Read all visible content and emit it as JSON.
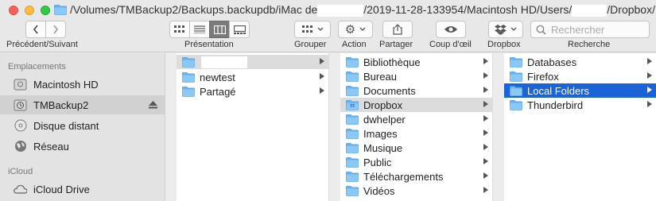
{
  "window": {
    "title_part1": "/Volumes/TMBackup2/Backups.backupdb/iMac de",
    "title_part2": "/2019-11-28-133954/Macintosh HD/Users/",
    "title_part3": "/Dropbox/Loc…"
  },
  "toolbar": {
    "nav_label": "Précédent/Suivant",
    "view_label": "Présentation",
    "group_label": "Grouper",
    "action_label": "Action",
    "share_label": "Partager",
    "quicklook_label": "Coup d'œil",
    "dropbox_label": "Dropbox",
    "search_label": "Recherche",
    "search_placeholder": "Rechercher"
  },
  "sidebar": {
    "locations_header": "Emplacements",
    "icloud_header": "iCloud",
    "items": [
      {
        "label": "Macintosh HD",
        "icon": "harddrive-icon"
      },
      {
        "label": "TMBackup2",
        "icon": "timemachine-disk-icon"
      },
      {
        "label": "Disque distant",
        "icon": "remote-disc-icon"
      },
      {
        "label": "Réseau",
        "icon": "network-globe-icon"
      },
      {
        "label": "iCloud Drive",
        "icon": "cloud-icon"
      }
    ]
  },
  "columns": {
    "col1": [
      {
        "label": "",
        "selected": true
      },
      {
        "label": "newtest"
      },
      {
        "label": "Partagé"
      }
    ],
    "col2": [
      {
        "label": "Bibliothèque"
      },
      {
        "label": "Bureau"
      },
      {
        "label": "Documents"
      },
      {
        "label": "Dropbox",
        "selected": true
      },
      {
        "label": "dwhelper"
      },
      {
        "label": "Images"
      },
      {
        "label": "Musique"
      },
      {
        "label": "Public"
      },
      {
        "label": "Téléchargements"
      },
      {
        "label": "Vidéos"
      }
    ],
    "col3": [
      {
        "label": "Databases"
      },
      {
        "label": "Firefox"
      },
      {
        "label": "Local Folders",
        "selected": true
      },
      {
        "label": "Thunderbird"
      }
    ]
  },
  "colors": {
    "accent_blue": "#1a64d8",
    "folder_blue": "#6ab4f0"
  }
}
